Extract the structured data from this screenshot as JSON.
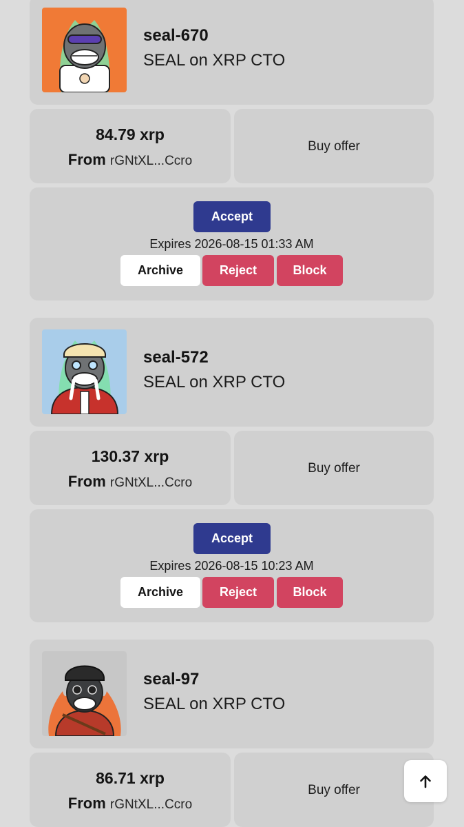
{
  "offers": [
    {
      "nft_name": "seal-670",
      "collection": "SEAL on XRP CTO",
      "price": "84.79 xrp",
      "from_label": "From",
      "from_address": "rGNtXL...Ccro",
      "offer_type": "Buy offer",
      "accept_label": "Accept",
      "expires": "Expires 2026-08-15 01:33 AM",
      "archive_label": "Archive",
      "reject_label": "Reject",
      "block_label": "Block",
      "thumbnail_bg": "#f07a36"
    },
    {
      "nft_name": "seal-572",
      "collection": "SEAL on XRP CTO",
      "price": "130.37 xrp",
      "from_label": "From",
      "from_address": "rGNtXL...Ccro",
      "offer_type": "Buy offer",
      "accept_label": "Accept",
      "expires": "Expires 2026-08-15 10:23 AM",
      "archive_label": "Archive",
      "reject_label": "Reject",
      "block_label": "Block",
      "thumbnail_bg": "#a9cdea"
    },
    {
      "nft_name": "seal-97",
      "collection": "SEAL on XRP CTO",
      "price": "86.71 xrp",
      "from_label": "From",
      "from_address": "rGNtXL...Ccro",
      "offer_type": "Buy offer",
      "thumbnail_bg": "#c7c7c7"
    }
  ],
  "scroll_top_icon": "arrow-up-icon",
  "colors": {
    "accept": "#2f3a8f",
    "reject": "#d24460",
    "block": "#d24460",
    "card": "#d0d0d0",
    "page": "#dcdcdc"
  }
}
